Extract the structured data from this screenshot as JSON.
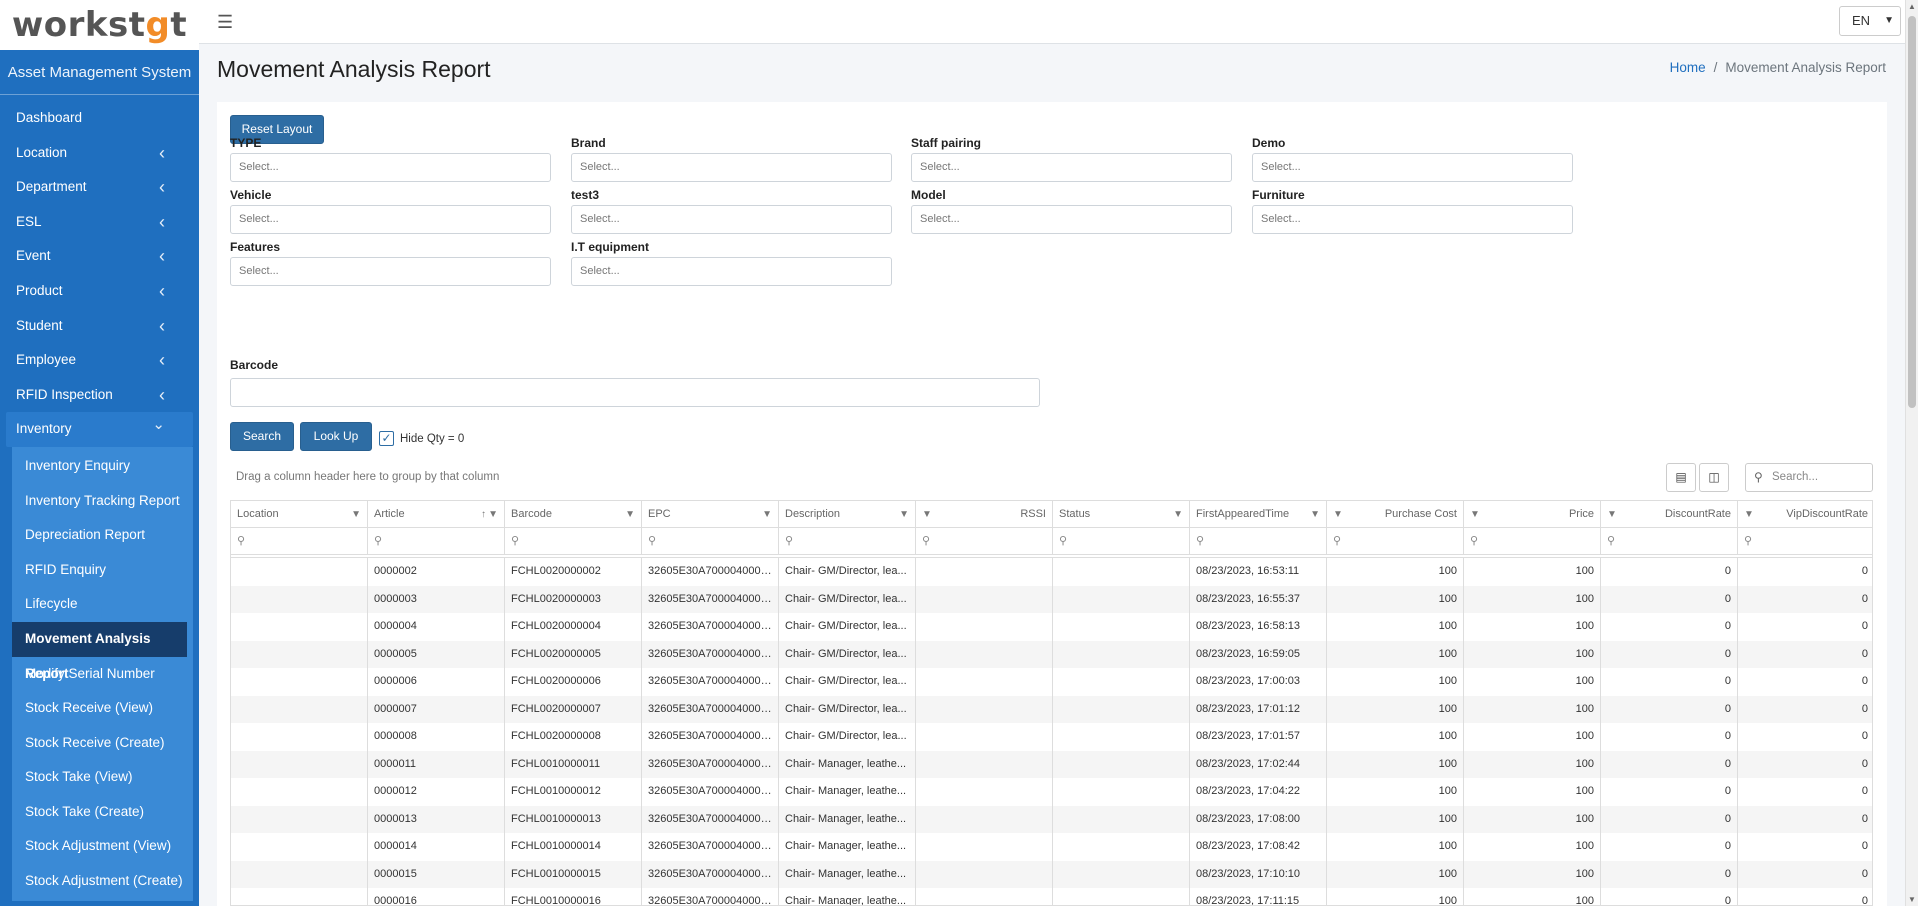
{
  "brand": {
    "logo_text_a": "workst",
    "logo_text_b": "g",
    "logo_text_c": "t",
    "app_title": "Asset Management System",
    "accent_color": "#f28c28",
    "sidebar_color": "#1f6fbf"
  },
  "nav": [
    {
      "label": "Dashboard",
      "has_chevron": false
    },
    {
      "label": "Location",
      "has_chevron": true
    },
    {
      "label": "Department",
      "has_chevron": true
    },
    {
      "label": "ESL",
      "has_chevron": true
    },
    {
      "label": "Event",
      "has_chevron": true
    },
    {
      "label": "Product",
      "has_chevron": true
    },
    {
      "label": "Student",
      "has_chevron": true
    },
    {
      "label": "Employee",
      "has_chevron": true
    },
    {
      "label": "RFID Inspection",
      "has_chevron": true
    },
    {
      "label": "Inventory",
      "has_chevron": true,
      "open": true
    }
  ],
  "inventory_submenu": [
    "Inventory Enquiry",
    "Inventory Tracking Report",
    "Depreciation Report",
    "RFID Enquiry",
    "Lifecycle",
    "Movement Analysis Report",
    "Modify Serial Number",
    "Stock Receive (View)",
    "Stock Receive (Create)",
    "Stock Take (View)",
    "Stock Take (Create)",
    "Stock Adjustment (View)",
    "Stock Adjustment (Create)"
  ],
  "active_submenu": "Movement Analysis Report",
  "topbar": {
    "language": "EN",
    "menu_icon": "hamburger-icon"
  },
  "page": {
    "title": "Movement Analysis Report",
    "breadcrumb_home": "Home",
    "breadcrumb_sep": "/",
    "breadcrumb_current": "Movement Analysis Report"
  },
  "reset_layout_label": "Reset Layout",
  "filters": [
    {
      "label": "TYPE",
      "placeholder": "Select..."
    },
    {
      "label": "Brand",
      "placeholder": "Select..."
    },
    {
      "label": "Staff pairing",
      "placeholder": "Select..."
    },
    {
      "label": "Demo",
      "placeholder": "Select..."
    },
    {
      "label": "Vehicle",
      "placeholder": "Select..."
    },
    {
      "label": "test3",
      "placeholder": "Select..."
    },
    {
      "label": "Model",
      "placeholder": "Select..."
    },
    {
      "label": "Furniture",
      "placeholder": "Select..."
    },
    {
      "label": "Features",
      "placeholder": "Select..."
    },
    {
      "label": "I.T equipment",
      "placeholder": "Select..."
    }
  ],
  "barcode": {
    "label": "Barcode",
    "value": ""
  },
  "actions": {
    "search_label": "Search",
    "lookup_label": "Look Up",
    "hide_qty_label": "Hide Qty = 0",
    "hide_qty_checked": true
  },
  "grid": {
    "group_hint": "Drag a column header here to group by that column",
    "search_placeholder": "Search...",
    "columns": [
      "Location",
      "Article",
      "Barcode",
      "EPC",
      "Description",
      "RSSI",
      "Status",
      "FirstAppearedTime",
      "Purchase Cost",
      "Price",
      "DiscountRate",
      "VipDiscountRate"
    ],
    "rows": [
      [
        "",
        "0000002",
        "FCHL0020000002",
        "32605E30A7000040000...",
        "Chair- GM/Director, lea...",
        "",
        "",
        "08/23/2023, 16:53:11",
        "100",
        "100",
        "0",
        "0"
      ],
      [
        "",
        "0000003",
        "FCHL0020000003",
        "32605E30A7000040000...",
        "Chair- GM/Director, lea...",
        "",
        "",
        "08/23/2023, 16:55:37",
        "100",
        "100",
        "0",
        "0"
      ],
      [
        "",
        "0000004",
        "FCHL0020000004",
        "32605E30A7000040000...",
        "Chair- GM/Director, lea...",
        "",
        "",
        "08/23/2023, 16:58:13",
        "100",
        "100",
        "0",
        "0"
      ],
      [
        "",
        "0000005",
        "FCHL0020000005",
        "32605E30A7000040000...",
        "Chair- GM/Director, lea...",
        "",
        "",
        "08/23/2023, 16:59:05",
        "100",
        "100",
        "0",
        "0"
      ],
      [
        "",
        "0000006",
        "FCHL0020000006",
        "32605E30A7000040000...",
        "Chair- GM/Director, lea...",
        "",
        "",
        "08/23/2023, 17:00:03",
        "100",
        "100",
        "0",
        "0"
      ],
      [
        "",
        "0000007",
        "FCHL0020000007",
        "32605E30A7000040000...",
        "Chair- GM/Director, lea...",
        "",
        "",
        "08/23/2023, 17:01:12",
        "100",
        "100",
        "0",
        "0"
      ],
      [
        "",
        "0000008",
        "FCHL0020000008",
        "32605E30A7000040000...",
        "Chair- GM/Director, lea...",
        "",
        "",
        "08/23/2023, 17:01:57",
        "100",
        "100",
        "0",
        "0"
      ],
      [
        "",
        "0000011",
        "FCHL0010000011",
        "32605E30A7000040000...",
        "Chair- Manager, leathe...",
        "",
        "",
        "08/23/2023, 17:02:44",
        "100",
        "100",
        "0",
        "0"
      ],
      [
        "",
        "0000012",
        "FCHL0010000012",
        "32605E30A7000040000...",
        "Chair- Manager, leathe...",
        "",
        "",
        "08/23/2023, 17:04:22",
        "100",
        "100",
        "0",
        "0"
      ],
      [
        "",
        "0000013",
        "FCHL0010000013",
        "32605E30A7000040000...",
        "Chair- Manager, leathe...",
        "",
        "",
        "08/23/2023, 17:08:00",
        "100",
        "100",
        "0",
        "0"
      ],
      [
        "",
        "0000014",
        "FCHL0010000014",
        "32605E30A7000040000...",
        "Chair- Manager, leathe...",
        "",
        "",
        "08/23/2023, 17:08:42",
        "100",
        "100",
        "0",
        "0"
      ],
      [
        "",
        "0000015",
        "FCHL0010000015",
        "32605E30A7000040000...",
        "Chair- Manager, leathe...",
        "",
        "",
        "08/23/2023, 17:10:10",
        "100",
        "100",
        "0",
        "0"
      ],
      [
        "",
        "0000016",
        "FCHL0010000016",
        "32605E30A7000040000...",
        "Chair- Manager, leathe...",
        "",
        "",
        "08/23/2023, 17:11:15",
        "100",
        "100",
        "0",
        "0"
      ]
    ]
  }
}
